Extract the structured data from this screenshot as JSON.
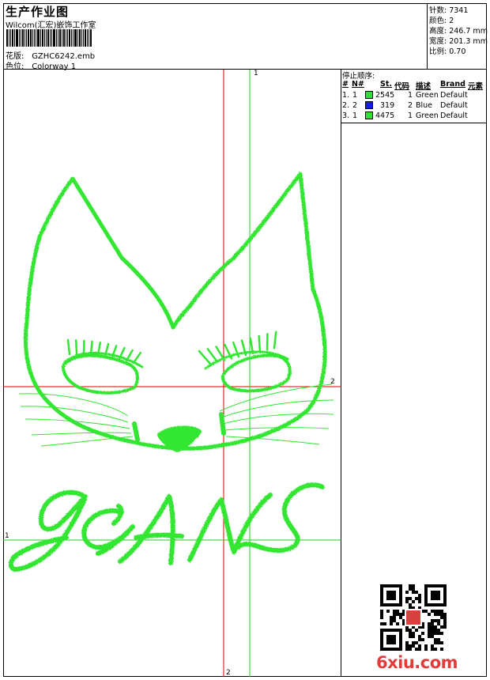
{
  "header": {
    "title": "生产作业图",
    "subtitle": "Wilcom(汇宏)嵌饰工作室",
    "design_label": "花版:",
    "design_value": "GZHC6242.emb",
    "color_label": "色位:",
    "color_value": "Colorway 1"
  },
  "stats": {
    "stitches": "针数: 7341",
    "colors": "颜色: 2",
    "height": "高度: 246.7 mm",
    "width": "宽度: 201.3 mm",
    "scale": "比例: 0.70"
  },
  "stop_sequence": {
    "caption": "停止顺序:",
    "headers": {
      "num": "#",
      "n": "N#",
      "st": "St.",
      "code": "代码",
      "desc": "描述",
      "brand": "Brand",
      "element": "元素"
    },
    "rows": [
      {
        "num": "1.",
        "n": "1",
        "swatch": "#33dd33",
        "st": "2545",
        "code": "1",
        "desc": "Green",
        "brand": "Default"
      },
      {
        "num": "2.",
        "n": "2",
        "swatch": "#1a1ae6",
        "st": "319",
        "code": "2",
        "desc": "Blue",
        "brand": "Default"
      },
      {
        "num": "3.",
        "n": "1",
        "swatch": "#33dd33",
        "st": "4475",
        "code": "1",
        "desc": "Green",
        "brand": "Default"
      }
    ]
  },
  "axis_labels": {
    "green_vertical": "1",
    "green_horizontal": "1",
    "red_vertical": "2",
    "red_horizontal": "2"
  },
  "colors": {
    "thread_green": "#33e633",
    "guide_red": "#e00000",
    "guide_green": "#22cc22"
  },
  "watermark": "6xiu.com"
}
